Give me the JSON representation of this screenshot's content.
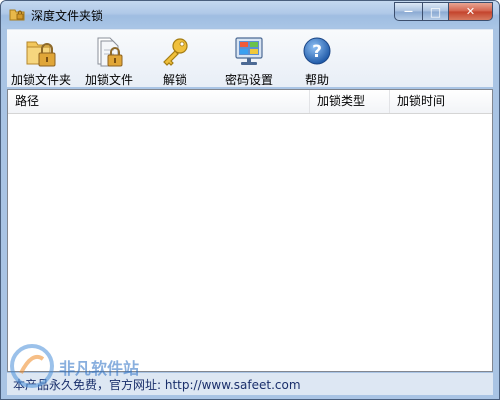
{
  "window": {
    "title": "深度文件夹锁"
  },
  "caption": {
    "minimize": "—",
    "maximize": "□",
    "close": "✕"
  },
  "toolbar": {
    "items": [
      {
        "label": "加锁文件夹",
        "icon": "folder-lock-icon"
      },
      {
        "label": "加锁文件",
        "icon": "file-lock-icon"
      },
      {
        "label": "解锁",
        "icon": "key-icon"
      },
      {
        "label": "密码设置",
        "icon": "password-settings-icon"
      },
      {
        "label": "帮助",
        "icon": "help-icon"
      }
    ]
  },
  "list": {
    "columns": [
      "路径",
      "加锁类型",
      "加锁时间"
    ],
    "rows": []
  },
  "status": {
    "text": "本产品永久免费，官方网址: http://www.safeet.com"
  },
  "watermark": {
    "text": "非凡软件站"
  },
  "colors": {
    "titlebar": "#b0c9e8",
    "close": "#c3422b",
    "accent": "#2a6fc4"
  }
}
